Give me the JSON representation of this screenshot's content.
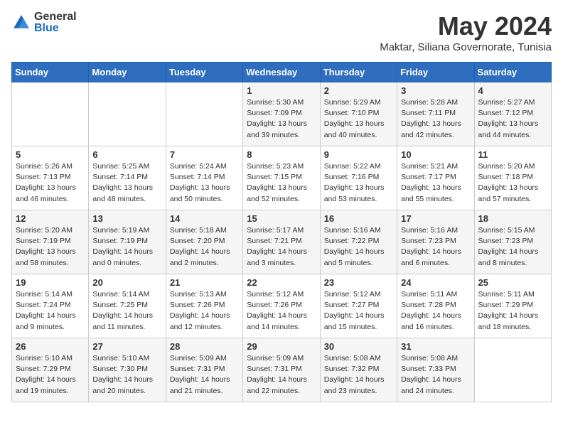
{
  "header": {
    "logo_general": "General",
    "logo_blue": "Blue",
    "month_title": "May 2024",
    "subtitle": "Maktar, Siliana Governorate, Tunisia"
  },
  "days_of_week": [
    "Sunday",
    "Monday",
    "Tuesday",
    "Wednesday",
    "Thursday",
    "Friday",
    "Saturday"
  ],
  "weeks": [
    [
      {
        "num": "",
        "detail": ""
      },
      {
        "num": "",
        "detail": ""
      },
      {
        "num": "",
        "detail": ""
      },
      {
        "num": "1",
        "detail": "Sunrise: 5:30 AM\nSunset: 7:09 PM\nDaylight: 13 hours\nand 39 minutes."
      },
      {
        "num": "2",
        "detail": "Sunrise: 5:29 AM\nSunset: 7:10 PM\nDaylight: 13 hours\nand 40 minutes."
      },
      {
        "num": "3",
        "detail": "Sunrise: 5:28 AM\nSunset: 7:11 PM\nDaylight: 13 hours\nand 42 minutes."
      },
      {
        "num": "4",
        "detail": "Sunrise: 5:27 AM\nSunset: 7:12 PM\nDaylight: 13 hours\nand 44 minutes."
      }
    ],
    [
      {
        "num": "5",
        "detail": "Sunrise: 5:26 AM\nSunset: 7:13 PM\nDaylight: 13 hours\nand 46 minutes."
      },
      {
        "num": "6",
        "detail": "Sunrise: 5:25 AM\nSunset: 7:14 PM\nDaylight: 13 hours\nand 48 minutes."
      },
      {
        "num": "7",
        "detail": "Sunrise: 5:24 AM\nSunset: 7:14 PM\nDaylight: 13 hours\nand 50 minutes."
      },
      {
        "num": "8",
        "detail": "Sunrise: 5:23 AM\nSunset: 7:15 PM\nDaylight: 13 hours\nand 52 minutes."
      },
      {
        "num": "9",
        "detail": "Sunrise: 5:22 AM\nSunset: 7:16 PM\nDaylight: 13 hours\nand 53 minutes."
      },
      {
        "num": "10",
        "detail": "Sunrise: 5:21 AM\nSunset: 7:17 PM\nDaylight: 13 hours\nand 55 minutes."
      },
      {
        "num": "11",
        "detail": "Sunrise: 5:20 AM\nSunset: 7:18 PM\nDaylight: 13 hours\nand 57 minutes."
      }
    ],
    [
      {
        "num": "12",
        "detail": "Sunrise: 5:20 AM\nSunset: 7:19 PM\nDaylight: 13 hours\nand 58 minutes."
      },
      {
        "num": "13",
        "detail": "Sunrise: 5:19 AM\nSunset: 7:19 PM\nDaylight: 14 hours\nand 0 minutes."
      },
      {
        "num": "14",
        "detail": "Sunrise: 5:18 AM\nSunset: 7:20 PM\nDaylight: 14 hours\nand 2 minutes."
      },
      {
        "num": "15",
        "detail": "Sunrise: 5:17 AM\nSunset: 7:21 PM\nDaylight: 14 hours\nand 3 minutes."
      },
      {
        "num": "16",
        "detail": "Sunrise: 5:16 AM\nSunset: 7:22 PM\nDaylight: 14 hours\nand 5 minutes."
      },
      {
        "num": "17",
        "detail": "Sunrise: 5:16 AM\nSunset: 7:23 PM\nDaylight: 14 hours\nand 6 minutes."
      },
      {
        "num": "18",
        "detail": "Sunrise: 5:15 AM\nSunset: 7:23 PM\nDaylight: 14 hours\nand 8 minutes."
      }
    ],
    [
      {
        "num": "19",
        "detail": "Sunrise: 5:14 AM\nSunset: 7:24 PM\nDaylight: 14 hours\nand 9 minutes."
      },
      {
        "num": "20",
        "detail": "Sunrise: 5:14 AM\nSunset: 7:25 PM\nDaylight: 14 hours\nand 11 minutes."
      },
      {
        "num": "21",
        "detail": "Sunrise: 5:13 AM\nSunset: 7:26 PM\nDaylight: 14 hours\nand 12 minutes."
      },
      {
        "num": "22",
        "detail": "Sunrise: 5:12 AM\nSunset: 7:26 PM\nDaylight: 14 hours\nand 14 minutes."
      },
      {
        "num": "23",
        "detail": "Sunrise: 5:12 AM\nSunset: 7:27 PM\nDaylight: 14 hours\nand 15 minutes."
      },
      {
        "num": "24",
        "detail": "Sunrise: 5:11 AM\nSunset: 7:28 PM\nDaylight: 14 hours\nand 16 minutes."
      },
      {
        "num": "25",
        "detail": "Sunrise: 5:11 AM\nSunset: 7:29 PM\nDaylight: 14 hours\nand 18 minutes."
      }
    ],
    [
      {
        "num": "26",
        "detail": "Sunrise: 5:10 AM\nSunset: 7:29 PM\nDaylight: 14 hours\nand 19 minutes."
      },
      {
        "num": "27",
        "detail": "Sunrise: 5:10 AM\nSunset: 7:30 PM\nDaylight: 14 hours\nand 20 minutes."
      },
      {
        "num": "28",
        "detail": "Sunrise: 5:09 AM\nSunset: 7:31 PM\nDaylight: 14 hours\nand 21 minutes."
      },
      {
        "num": "29",
        "detail": "Sunrise: 5:09 AM\nSunset: 7:31 PM\nDaylight: 14 hours\nand 22 minutes."
      },
      {
        "num": "30",
        "detail": "Sunrise: 5:08 AM\nSunset: 7:32 PM\nDaylight: 14 hours\nand 23 minutes."
      },
      {
        "num": "31",
        "detail": "Sunrise: 5:08 AM\nSunset: 7:33 PM\nDaylight: 14 hours\nand 24 minutes."
      },
      {
        "num": "",
        "detail": ""
      }
    ]
  ]
}
